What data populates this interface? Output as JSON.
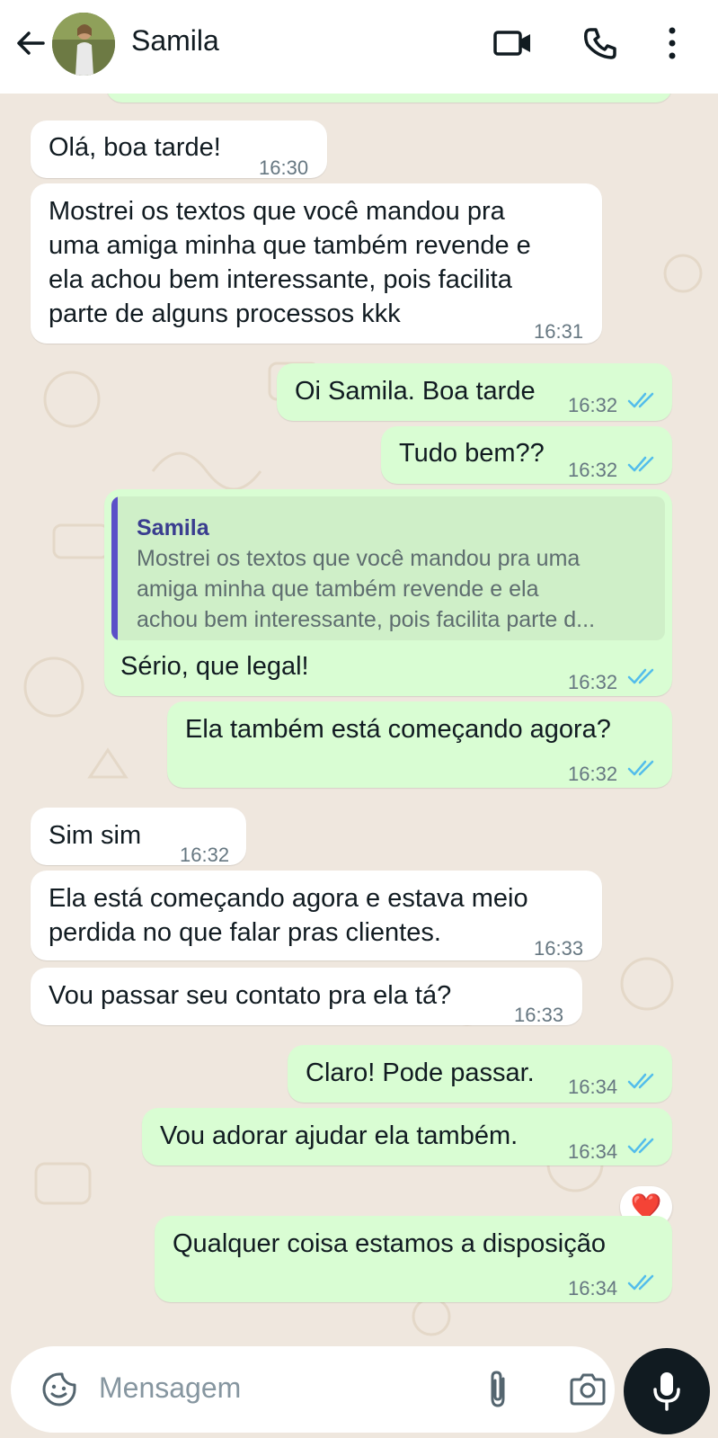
{
  "header": {
    "contact_name": "Samila",
    "icons": [
      "back-arrow-icon",
      "avatar",
      "video-call-icon",
      "voice-call-icon",
      "more-options-icon"
    ]
  },
  "messages": [
    {
      "direction": "in",
      "text": "Olá, boa tarde!",
      "time": "16:30"
    },
    {
      "direction": "in",
      "text": "Mostrei os textos que você mandou pra\numa amiga minha que também revende e\nela achou bem interessante, pois facilita\nparte de alguns processos kkk",
      "time": "16:31"
    },
    {
      "direction": "out",
      "text": "Oi Samila. Boa tarde",
      "time": "16:32",
      "status": "read"
    },
    {
      "direction": "out",
      "text": "Tudo bem??",
      "time": "16:32",
      "status": "read"
    },
    {
      "direction": "out",
      "quote": {
        "author": "Samila",
        "text": "Mostrei os textos que você mandou pra uma\namiga minha que também revende e ela\nachou bem interessante, pois facilita parte d..."
      },
      "text": "Sério, que legal!",
      "time": "16:32",
      "status": "read"
    },
    {
      "direction": "out",
      "text": "Ela também está começando agora?",
      "time": "16:32",
      "status": "read"
    },
    {
      "direction": "in",
      "text": "Sim sim",
      "time": "16:32"
    },
    {
      "direction": "in",
      "text": "Ela está começando agora e estava meio\nperdida no que falar pras clientes.",
      "time": "16:33"
    },
    {
      "direction": "in",
      "text": "Vou passar seu contato pra ela tá?",
      "time": "16:33"
    },
    {
      "direction": "out",
      "text": "Claro! Pode passar.",
      "time": "16:34",
      "status": "read"
    },
    {
      "direction": "out",
      "text": "Vou adorar ajudar ela também.",
      "time": "16:34",
      "status": "read",
      "reaction": "❤️"
    },
    {
      "direction": "out",
      "text": "Qualquer coisa estamos a disposição",
      "time": "16:34",
      "status": "read"
    }
  ],
  "composer": {
    "placeholder": "Mensagem",
    "icons": [
      "emoji-sticker-icon",
      "attach-icon",
      "camera-icon",
      "mic-icon"
    ]
  },
  "colors": {
    "incoming_bubble": "#ffffff",
    "outgoing_bubble": "#d9fdd3",
    "read_ticks": "#53bdeb",
    "chat_background": "#efe7de",
    "quote_bar": "#5b4fc8"
  }
}
